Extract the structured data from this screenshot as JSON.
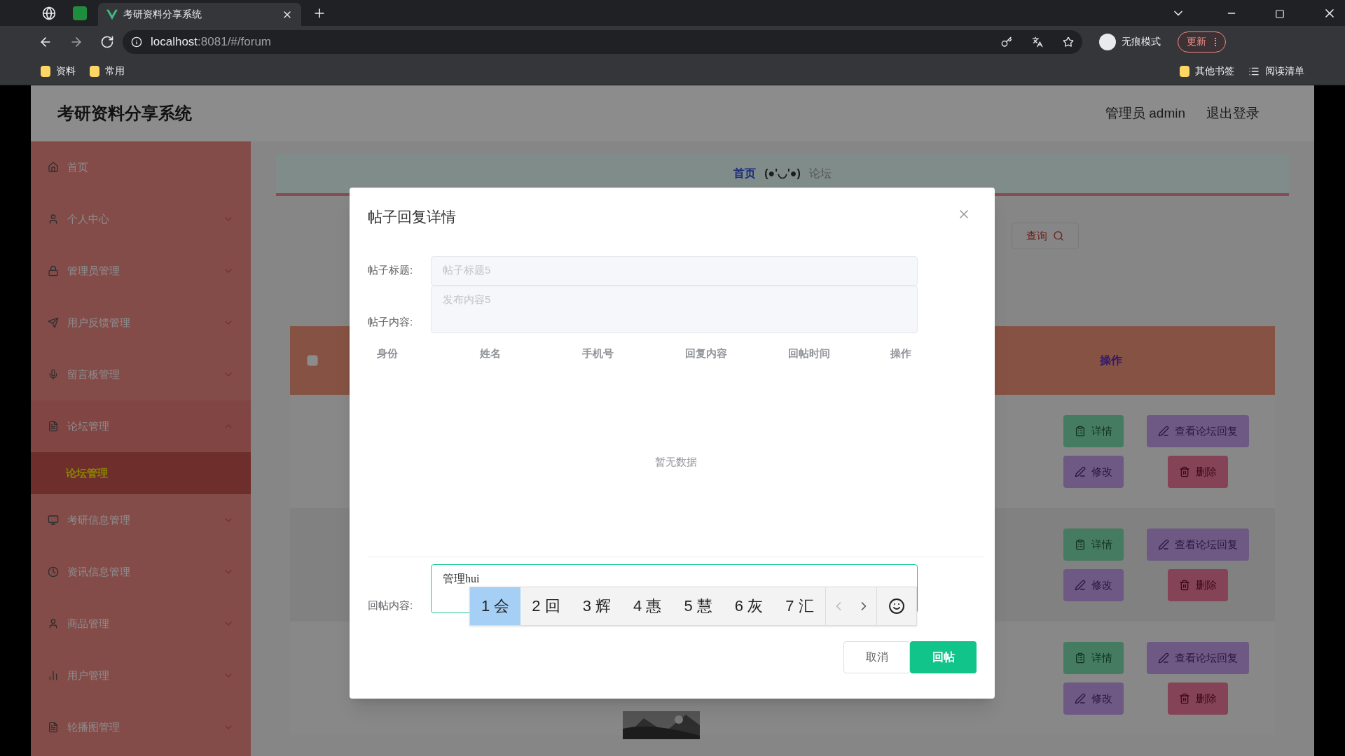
{
  "browser": {
    "tabs": [
      {
        "title": "考研资料分享系统",
        "selected": true
      }
    ],
    "url_host": "localhost",
    "url_rest": ":8081/#/forum",
    "bookmarks": [
      "资料",
      "常用"
    ],
    "right_bookmarks": [
      "其他书签",
      "阅读清单"
    ],
    "incognito": "无痕模式",
    "update": "更新"
  },
  "app": {
    "title": "考研资料分享系统",
    "user": "管理员 admin",
    "logout": "退出登录"
  },
  "sidebar": [
    {
      "label": "首页",
      "kind": "home"
    },
    {
      "label": "个人中心",
      "kind": "user",
      "expanded": false
    },
    {
      "label": "管理员管理",
      "kind": "lock",
      "expanded": false
    },
    {
      "label": "用户反馈管理",
      "kind": "send",
      "expanded": false
    },
    {
      "label": "留言板管理",
      "kind": "mic",
      "expanded": false
    },
    {
      "label": "论坛管理",
      "kind": "doc",
      "expanded": true,
      "children": [
        {
          "label": "论坛管理",
          "selected": true
        }
      ]
    },
    {
      "label": "考研信息管理",
      "kind": "monitor",
      "expanded": false
    },
    {
      "label": "资讯信息管理",
      "kind": "clock",
      "expanded": false
    },
    {
      "label": "商品管理",
      "kind": "user",
      "expanded": false
    },
    {
      "label": "用户管理",
      "kind": "chart",
      "expanded": false
    },
    {
      "label": "轮播图管理",
      "kind": "doc",
      "expanded": false
    }
  ],
  "breadcrumb": [
    {
      "label": "首页",
      "kind": "link"
    },
    {
      "label": "(●'◡'●)",
      "kind": "face"
    },
    {
      "label": "论坛",
      "kind": "current"
    }
  ],
  "search_button": "查询",
  "table": {
    "header_checked": false,
    "header_last": "操作",
    "rows": [
      {
        "actions": [
          "详情",
          "查看论坛回复",
          "修改",
          "删除"
        ]
      },
      {
        "actions": [
          "详情",
          "查看论坛回复",
          "修改",
          "删除"
        ]
      },
      {
        "actions": [
          "详情",
          "查看论坛回复",
          "修改",
          "删除"
        ]
      }
    ]
  },
  "modal": {
    "title": "帖子回复详情",
    "title_label": "帖子标题:",
    "title_value": "帖子标题5",
    "content_label": "帖子内容:",
    "content_value": "发布内容5",
    "columns": [
      "身份",
      "姓名",
      "手机号",
      "回复内容",
      "回帖时间",
      "操作"
    ],
    "empty": "暂无数据",
    "reply_label": "回帖内容:",
    "reply_value": "管理hui",
    "ime": [
      {
        "label": "1 会",
        "selected": true
      },
      {
        "label": "2 回",
        "selected": false
      },
      {
        "label": "3 辉",
        "selected": false
      },
      {
        "label": "4 惠",
        "selected": false
      },
      {
        "label": "5 慧",
        "selected": false
      },
      {
        "label": "6 灰",
        "selected": false
      },
      {
        "label": "7 汇",
        "selected": false
      }
    ],
    "cancel": "取消",
    "submit": "回帖"
  }
}
